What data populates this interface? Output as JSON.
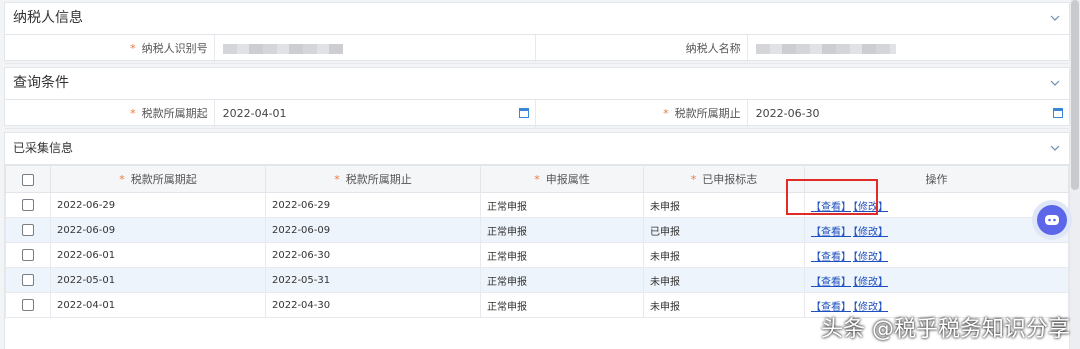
{
  "taxpayer": {
    "title": "纳税人信息",
    "id_label": "纳税人识别号",
    "name_label": "纳税人名称"
  },
  "query": {
    "title": "查询条件",
    "start_label": "税款所属期起",
    "start_value": "2022-04-01",
    "end_label": "税款所属期止",
    "end_value": "2022-06-30"
  },
  "collected": {
    "title": "已采集信息",
    "columns": [
      "税款所属期起",
      "税款所属期止",
      "申报属性",
      "已申报标志",
      "操作"
    ],
    "rows": [
      {
        "start": "2022-06-29",
        "end": "2022-06-29",
        "attr": "正常申报",
        "flag": "未申报"
      },
      {
        "start": "2022-06-09",
        "end": "2022-06-09",
        "attr": "正常申报",
        "flag": "已申报"
      },
      {
        "start": "2022-06-01",
        "end": "2022-06-30",
        "attr": "正常申报",
        "flag": "未申报"
      },
      {
        "start": "2022-05-01",
        "end": "2022-05-31",
        "attr": "正常申报",
        "flag": "未申报"
      },
      {
        "start": "2022-04-01",
        "end": "2022-04-30",
        "attr": "正常申报",
        "flag": "未申报"
      }
    ],
    "view_label": "【查看】",
    "edit_label": "【修改】"
  },
  "required_mark": "*",
  "watermark": "头条 @税乎税务知识分享",
  "colors": {
    "accent": "#3a86d6",
    "required": "#f0763b",
    "highlight": "#e02b27",
    "link": "#1d4fbf"
  }
}
